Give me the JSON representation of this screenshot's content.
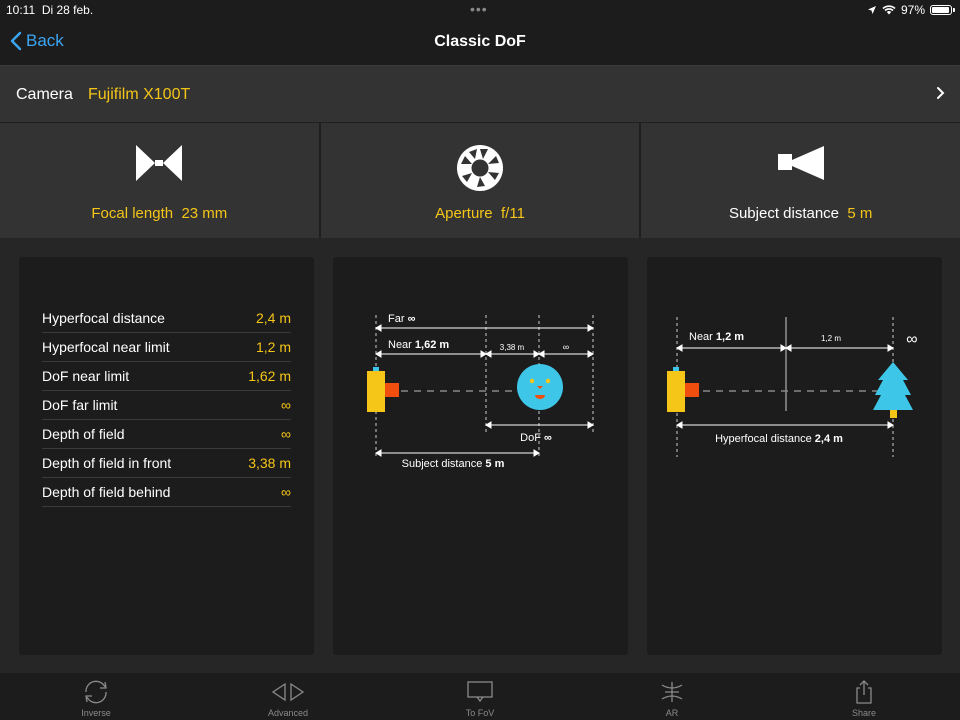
{
  "status": {
    "time": "10:11",
    "date": "Di 28 feb.",
    "battery": "97%",
    "battery_level": 0.97
  },
  "nav": {
    "back": "Back",
    "title": "Classic DoF"
  },
  "camera": {
    "label": "Camera",
    "value": "Fujifilm X100T"
  },
  "params": {
    "focal": {
      "label": "Focal length",
      "value": "23 mm"
    },
    "aperture": {
      "label": "Aperture",
      "value": "f/11"
    },
    "subject": {
      "label": "Subject distance",
      "value": "5 m"
    }
  },
  "results": [
    {
      "label": "Hyperfocal distance",
      "value": "2,4 m"
    },
    {
      "label": "Hyperfocal near limit",
      "value": "1,2 m"
    },
    {
      "label": "DoF near limit",
      "value": "1,62 m"
    },
    {
      "label": "DoF far limit",
      "value": "∞"
    },
    {
      "label": "Depth of field",
      "value": "∞"
    },
    {
      "label": "Depth of field in front",
      "value": "3,38 m"
    },
    {
      "label": "Depth of field behind",
      "value": "∞"
    }
  ],
  "diagram1": {
    "far_label": "Far",
    "far_value": "∞",
    "near_label": "Near",
    "near_value": "1,62 m",
    "front_value": "3,38 m",
    "behind_value": "∞",
    "dof_label": "DoF",
    "dof_value": "∞",
    "subject_label": "Subject distance",
    "subject_value": "5 m"
  },
  "diagram2": {
    "near_label": "Near",
    "near_value": "1,2 m",
    "mid_value": "1,2 m",
    "inf": "∞",
    "hyper_label": "Hyperfocal distance",
    "hyper_value": "2,4 m"
  },
  "tabs": [
    "Inverse",
    "Advanced",
    "To FoV",
    "AR",
    "Share"
  ],
  "colors": {
    "accent": "#f5c518",
    "link": "#3ba7f5",
    "camera_body": "#f5c518",
    "lens": "#f04e0f",
    "face": "#3ec6e8",
    "tree": "#3ec6e8"
  }
}
